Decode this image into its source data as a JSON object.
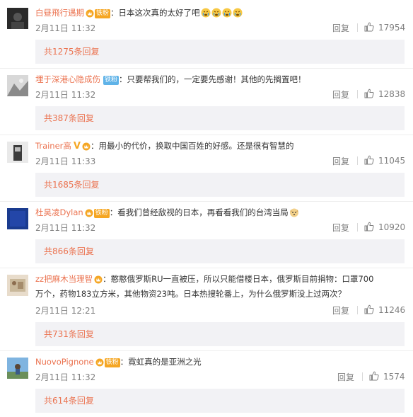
{
  "comments": [
    {
      "user": "白昼飛行遇期",
      "text": "：日本这次真的太好了吧",
      "date": "2月11日 11:32",
      "reply": "回复",
      "likes": "17954",
      "sub_replies": "共1275条回复",
      "badge": "铁粉"
    },
    {
      "user": "埋于深港心隐成伤",
      "text": "：只要帮我们的，一定要先感谢！其他的先搁置吧！",
      "date": "2月11日 11:32",
      "reply": "回复",
      "likes": "12838",
      "sub_replies": "共387条回复",
      "badge": "铁粉"
    },
    {
      "user": "Trainer高",
      "text": "：用最小的代价，换取中国百姓的好感。还是很有智慧的",
      "date": "2月11日 11:33",
      "reply": "回复",
      "likes": "11045",
      "sub_replies": "共1685条回复",
      "verified": "V"
    },
    {
      "user": "杜昊凌Dylan",
      "text": "：看我们曾经敌视的日本，再看看我们的台湾当局",
      "date": "2月11日 11:32",
      "reply": "回复",
      "likes": "10920",
      "sub_replies": "共866条回复",
      "badge": "铁粉"
    },
    {
      "user": "zz把麻木当理智",
      "text": "：憨憨俄罗斯RU一直被压，所以只能借楼日本，俄罗斯目前捐物：口罩700万个，药物183立方米，其他物资23吨。日本热搜轮番上，为什么俄罗斯没上过两次？",
      "date": "2月11日 12:21",
      "reply": "回复",
      "likes": "11246",
      "sub_replies": "共731条回复"
    },
    {
      "user": "NuovoPignone",
      "text": "：霓虹真的是亚洲之光",
      "date": "2月11日 11:32",
      "reply": "回复",
      "likes": "1574",
      "sub_replies": "共614条回复",
      "badge": "铁粉"
    }
  ],
  "colors": {
    "username": "#eb7350",
    "meta": "#808080",
    "sub_bg": "#f2f2f5",
    "badge_orange": "#f5a623",
    "badge_blue": "#5fb3e8"
  },
  "icons": {
    "like": "thumbs-up-icon",
    "member": "vip-crown-icon",
    "emoji": "crying-face-icon"
  }
}
